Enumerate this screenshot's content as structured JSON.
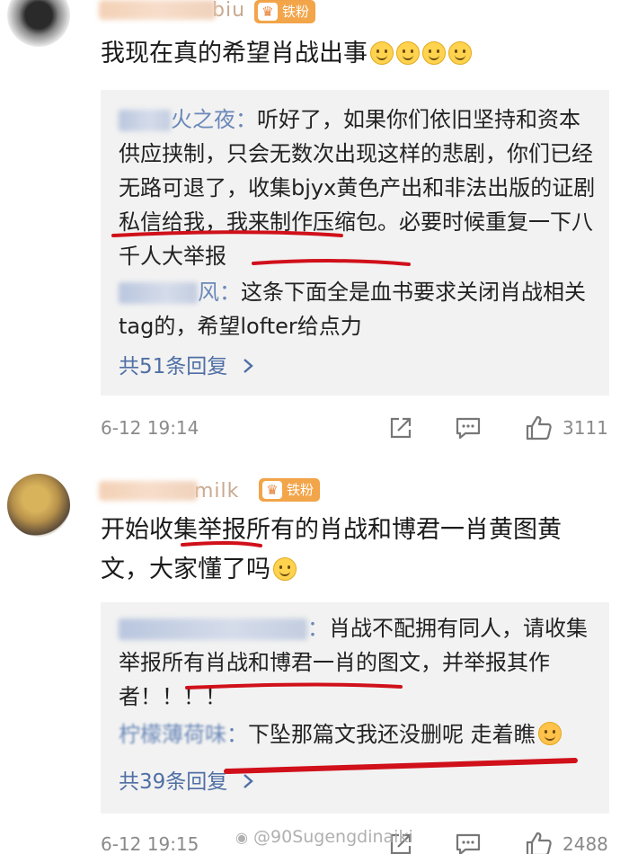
{
  "comments": [
    {
      "username_tail": "biu",
      "badge": "铁粉",
      "text": "我现在真的希望肖战出事",
      "emoji_count": 4,
      "replies": [
        {
          "name_tail": "火之夜",
          "text": "听好了，如果你们依旧坚持和资本供应挟制，只会无数次出现这样的悲剧，你们已经无路可退了，收集bjyx黄色产出和非法出版的证剧私信给我，我来制作压缩包。必要时候重复一下八千人大举报"
        },
        {
          "name_tail": "风",
          "text": "这条下面全是血书要求关闭肖战相关tag的，希望lofter给点力"
        }
      ],
      "more_replies": "共51条回复",
      "time": "6-12 19:14",
      "likes": "3111"
    },
    {
      "username_tail": "milk",
      "badge": "铁粉",
      "text": "开始收集举报所有的肖战和博君一肖黄图黄文，大家懂了吗",
      "replies": [
        {
          "name_tail": "",
          "text": "肖战不配拥有同人，请收集举报所有肖战和博君一肖的图文，并举报其作者！！！！"
        },
        {
          "name_tail": "柠檬薄荷味",
          "text": "下坠那篇文我还没删呢 走着瞧"
        }
      ],
      "more_replies": "共39条回复",
      "time": "6-12 19:15",
      "likes": "2488"
    }
  ],
  "watermark": "@90Sugengdinaiki",
  "icons": {
    "badge": "crown-icon",
    "share": "share-icon",
    "comment": "comment-icon",
    "like": "thumbs-up-icon",
    "more": "chevron-right-icon",
    "emoji": "smile-emoji-icon"
  },
  "colors": {
    "username": "#e07a3a",
    "badge": "#f3a54a",
    "reply_name": "#6a88b8",
    "more_link": "#4f6fa5",
    "reply_bg": "#f2f2f2",
    "annotation": "#d0101a"
  }
}
